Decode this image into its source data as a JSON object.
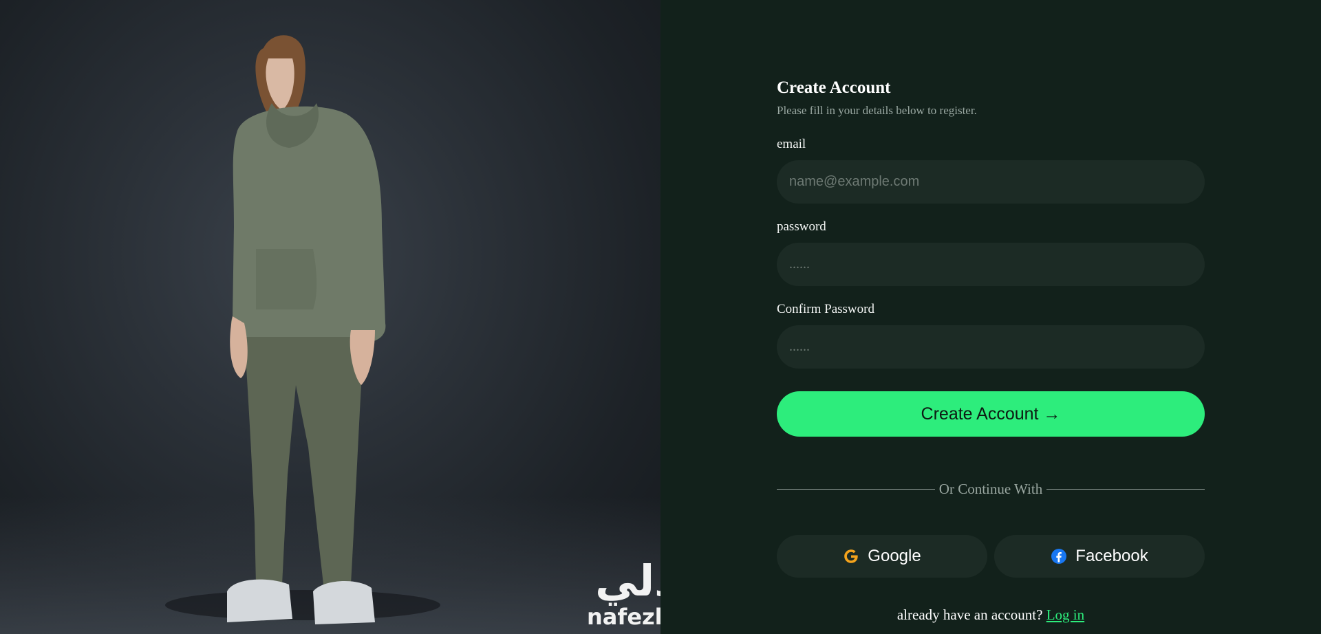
{
  "watermark": {
    "arabic": "نفذلي",
    "latin": "nafezly.com"
  },
  "form": {
    "title": "Create Account",
    "subtitle": "Please fill in your details below to register.",
    "email_label": "email",
    "email_placeholder": "name@example.com",
    "password_label": "password",
    "password_placeholder": "......",
    "confirm_label": "Confirm Password",
    "confirm_placeholder": "......",
    "submit_label": "Create Account →",
    "divider_text": "Or Continue With",
    "google_label": "Google",
    "facebook_label": "Facebook",
    "footer_text": "already have an account?",
    "login_link": "Log in"
  },
  "colors": {
    "accent": "#2ded7c",
    "panel_bg": "#12211b",
    "input_bg": "#1c2b25",
    "google_icon": "#f4a31c",
    "facebook_icon": "#1877f2"
  },
  "icons": {
    "google": "google-icon",
    "facebook": "facebook-icon"
  }
}
